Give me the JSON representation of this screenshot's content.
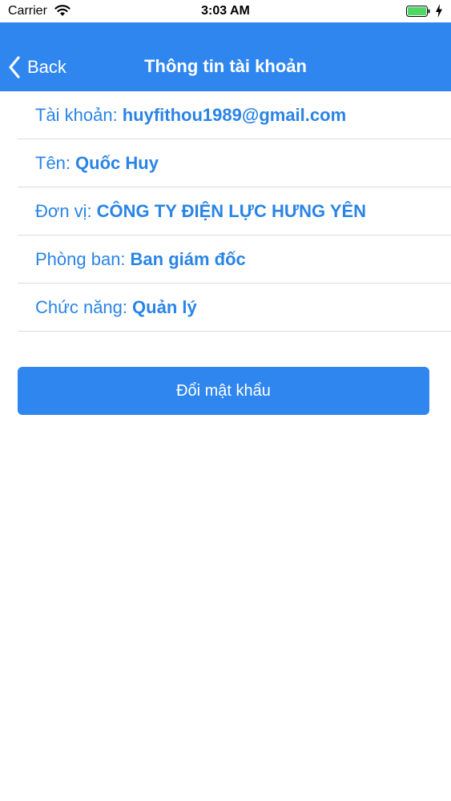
{
  "status_bar": {
    "carrier": "Carrier",
    "time": "3:03 AM",
    "wifi_icon": "wifi-icon",
    "battery_icon": "battery-icon",
    "charging_icon": "bolt-icon"
  },
  "nav": {
    "back_label": "Back",
    "title": "Thông tin tài khoản",
    "color": "#2f86ef"
  },
  "account": {
    "rows": [
      {
        "label": "Tài khoản:",
        "value": "huyfithou1989@gmail.com"
      },
      {
        "label": "Tên:",
        "value": "Quốc Huy"
      },
      {
        "label": "Đơn vị:",
        "value": "CÔNG TY ĐIỆN LỰC HƯNG YÊN"
      },
      {
        "label": "Phòng ban:",
        "value": "Ban giám đốc"
      },
      {
        "label": "Chức năng:",
        "value": "Quản lý"
      }
    ]
  },
  "actions": {
    "change_password_label": "Đổi mật khẩu"
  },
  "colors": {
    "accent": "#2f86ef",
    "text_blue": "#2a84e6",
    "divider": "#dcdcdc",
    "battery_green": "#4cd964"
  }
}
